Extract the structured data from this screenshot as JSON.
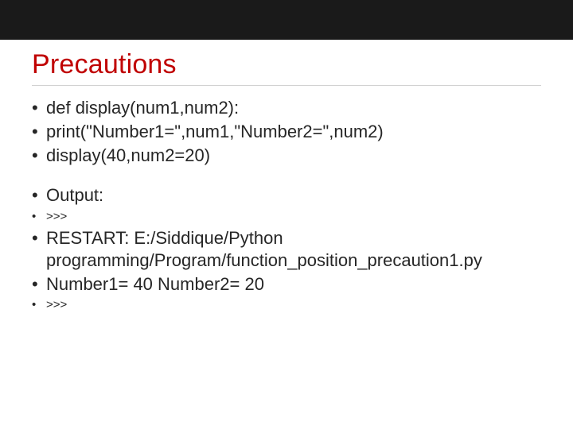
{
  "title": "Precautions",
  "code": {
    "line1": "def display(num1,num2):",
    "line2": "    print(\"Number1=\",num1,\"Number2=\",num2)",
    "line3": "display(40,num2=20)"
  },
  "output": {
    "label": "Output:",
    "prompt1": ">>>",
    "restart": "  RESTART: E:/Siddique/Python programming/Program/function_position_precaution1.py",
    "result": "Number1= 40 Number2= 20",
    "prompt2": ">>>"
  }
}
